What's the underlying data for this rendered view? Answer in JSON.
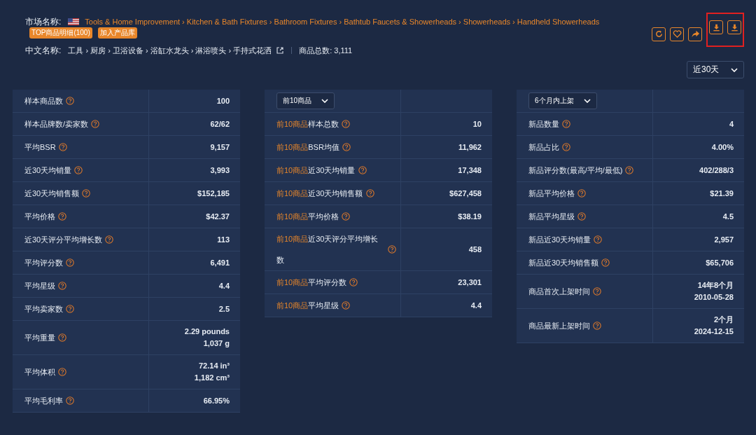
{
  "market": {
    "label": "市场名称:",
    "path": "Tools & Home Improvement › Kitchen & Bath Fixtures › Bathroom Fixtures › Bathtub Faucets & Showerheads › Showerheads › Handheld Showerheads",
    "badges": [
      "TOP商品明细(100)",
      "加入产品库"
    ]
  },
  "chinese": {
    "label": "中文名称:",
    "path": "工具 › 厨房 › 卫浴设备 › 浴缸水龙头 › 淋浴喷头 › 手持式花洒",
    "total": "商品总数: 3,111"
  },
  "actions": [
    {
      "kind": "refresh",
      "highlighted": false
    },
    {
      "kind": "heart",
      "highlighted": false
    },
    {
      "kind": "share",
      "highlighted": false
    },
    {
      "kind": "download",
      "highlighted": true
    },
    {
      "kind": "download",
      "highlighted": true
    }
  ],
  "period": {
    "value": "近30天"
  },
  "tables": [
    {
      "rows": [
        {
          "label": "样本商品数",
          "value": [
            "100"
          ]
        },
        {
          "label": "样本品牌数/卖家数",
          "value": [
            "62/62"
          ]
        },
        {
          "label": "平均BSR",
          "value": [
            "9,157"
          ]
        },
        {
          "label": "近30天均销量",
          "value": [
            "3,993"
          ]
        },
        {
          "label": "近30天均销售额",
          "value": [
            "$152,185"
          ]
        },
        {
          "label": "平均价格",
          "value": [
            "$42.37"
          ]
        },
        {
          "label": "近30天评分平均增长数",
          "value": [
            "113"
          ]
        },
        {
          "label": "平均评分数",
          "value": [
            "6,491"
          ]
        },
        {
          "label": "平均星级",
          "value": [
            "4.4"
          ]
        },
        {
          "label": "平均卖家数",
          "value": [
            "2.5"
          ]
        },
        {
          "label": "平均重量",
          "value": [
            "2.29 pounds",
            "1,037 g"
          ]
        },
        {
          "label": "平均体积",
          "value": [
            "72.14 in³",
            "1,182 cm³"
          ]
        },
        {
          "label": "平均毛利率",
          "value": [
            "66.95%"
          ]
        }
      ]
    },
    {
      "dropdown": "前10商品",
      "rows": [
        {
          "prefix": "前10商品",
          "label": "样本总数",
          "value": [
            "10"
          ]
        },
        {
          "prefix": "前10商品",
          "label": "BSR均值",
          "value": [
            "11,962"
          ]
        },
        {
          "prefix": "前10商品",
          "label": "近30天均销量",
          "value": [
            "17,348"
          ]
        },
        {
          "prefix": "前10商品",
          "label": "近30天均销售额",
          "value": [
            "$627,458"
          ]
        },
        {
          "prefix": "前10商品",
          "label": "平均价格",
          "value": [
            "$38.19"
          ]
        },
        {
          "prefix": "前10商品",
          "label": "近30天评分平均增长数",
          "value": [
            "458"
          ]
        },
        {
          "prefix": "前10商品",
          "label": "平均评分数",
          "value": [
            "23,301"
          ]
        },
        {
          "prefix": "前10商品",
          "label": "平均星级",
          "value": [
            "4.4"
          ]
        }
      ]
    },
    {
      "dropdown": "6个月内上架",
      "rows": [
        {
          "label": "新品数量",
          "value": [
            "4"
          ]
        },
        {
          "label": "新品占比",
          "value": [
            "4.00%"
          ]
        },
        {
          "label": "新品评分数(最高/平均/最低)",
          "value": [
            "402/288/3"
          ]
        },
        {
          "label": "新品平均价格",
          "value": [
            "$21.39"
          ]
        },
        {
          "label": "新品平均星级",
          "value": [
            "4.5"
          ]
        },
        {
          "label": "新品近30天均销量",
          "value": [
            "2,957"
          ]
        },
        {
          "label": "新品近30天均销售额",
          "value": [
            "$65,706"
          ]
        },
        {
          "label": "商品首次上架时间",
          "value": [
            "14年8个月",
            "2010-05-28"
          ]
        },
        {
          "label": "商品最新上架时间",
          "value": [
            "2个月",
            "2024-12-15"
          ]
        }
      ]
    }
  ]
}
